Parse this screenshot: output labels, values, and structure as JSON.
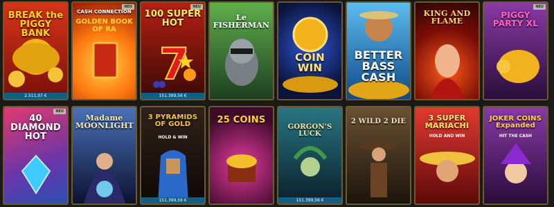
{
  "badge_new": "NEU",
  "tiles": [
    {
      "id": "break-the-piggy-bank",
      "title": "BREAK the PIGGY BANK",
      "jackpot": "2.511,07 €",
      "colors": [
        "#d8341a",
        "#7a0f08"
      ]
    },
    {
      "id": "golden-book-of-ra",
      "title": "CASH CONNECTION",
      "subtitle": "GOLDEN BOOK OF RA",
      "colors": [
        "#ff9a1f",
        "#b3260a"
      ]
    },
    {
      "id": "100-super-hot",
      "title": "100 SUPER HOT",
      "jackpot": "151.399,56 €",
      "colors": [
        "#b62013",
        "#3b0904"
      ]
    },
    {
      "id": "le-fisherman",
      "title": "Le FISHERMAN",
      "colors": [
        "#4a9e44",
        "#1d3f22"
      ]
    },
    {
      "id": "coin-win",
      "title": "COIN WIN",
      "colors": [
        "#20399c",
        "#0b1338"
      ]
    },
    {
      "id": "better-bass-cash",
      "title": "BETTER BASS CASH",
      "colors": [
        "#38a4e0",
        "#104a8b"
      ]
    },
    {
      "id": "king-and-flame",
      "title": "KING AND FLAME",
      "colors": [
        "#b51c12",
        "#2e0603"
      ]
    },
    {
      "id": "piggy-party-xl",
      "title": "PIGGY PARTY XL",
      "colors": [
        "#6a2d86",
        "#2a0e3a"
      ]
    },
    {
      "id": "40-diamond-hot",
      "title": "40 DIAMOND HOT",
      "colors": [
        "#d9317a",
        "#3a1f7a"
      ]
    },
    {
      "id": "madame-moonlight",
      "title": "Madame MOONLIGHT",
      "colors": [
        "#3e62a6",
        "#0c1231"
      ]
    },
    {
      "id": "3-pyramids-of-gold",
      "title": "3 PYRAMIDS OF GOLD",
      "subtitle": "HOLD & WIN",
      "jackpot": "151.399,56 €",
      "colors": [
        "#31211a",
        "#0d0806"
      ]
    },
    {
      "id": "25-coins",
      "title": "25 COINS",
      "colors": [
        "#b7177a",
        "#3e0b2a"
      ]
    },
    {
      "id": "gorgons-luck",
      "title": "GORGON'S LUCK",
      "jackpot": "151.399,56 €",
      "colors": [
        "#1e5a68",
        "#09202a"
      ]
    },
    {
      "id": "2-wild-2-die",
      "title": "2 WILD 2 DIE",
      "colors": [
        "#6a5132",
        "#1c140b"
      ]
    },
    {
      "id": "3-super-mariachi",
      "title": "3 SUPER MARIACHI",
      "subtitle": "HOLD AND WIN",
      "colors": [
        "#d8282a",
        "#5d0a0a"
      ]
    },
    {
      "id": "joker-coins-expanded",
      "title": "JOKER COINS Expanded",
      "subtitle": "HIT THE CASH",
      "colors": [
        "#7a2d86",
        "#2a0c3a"
      ]
    }
  ]
}
